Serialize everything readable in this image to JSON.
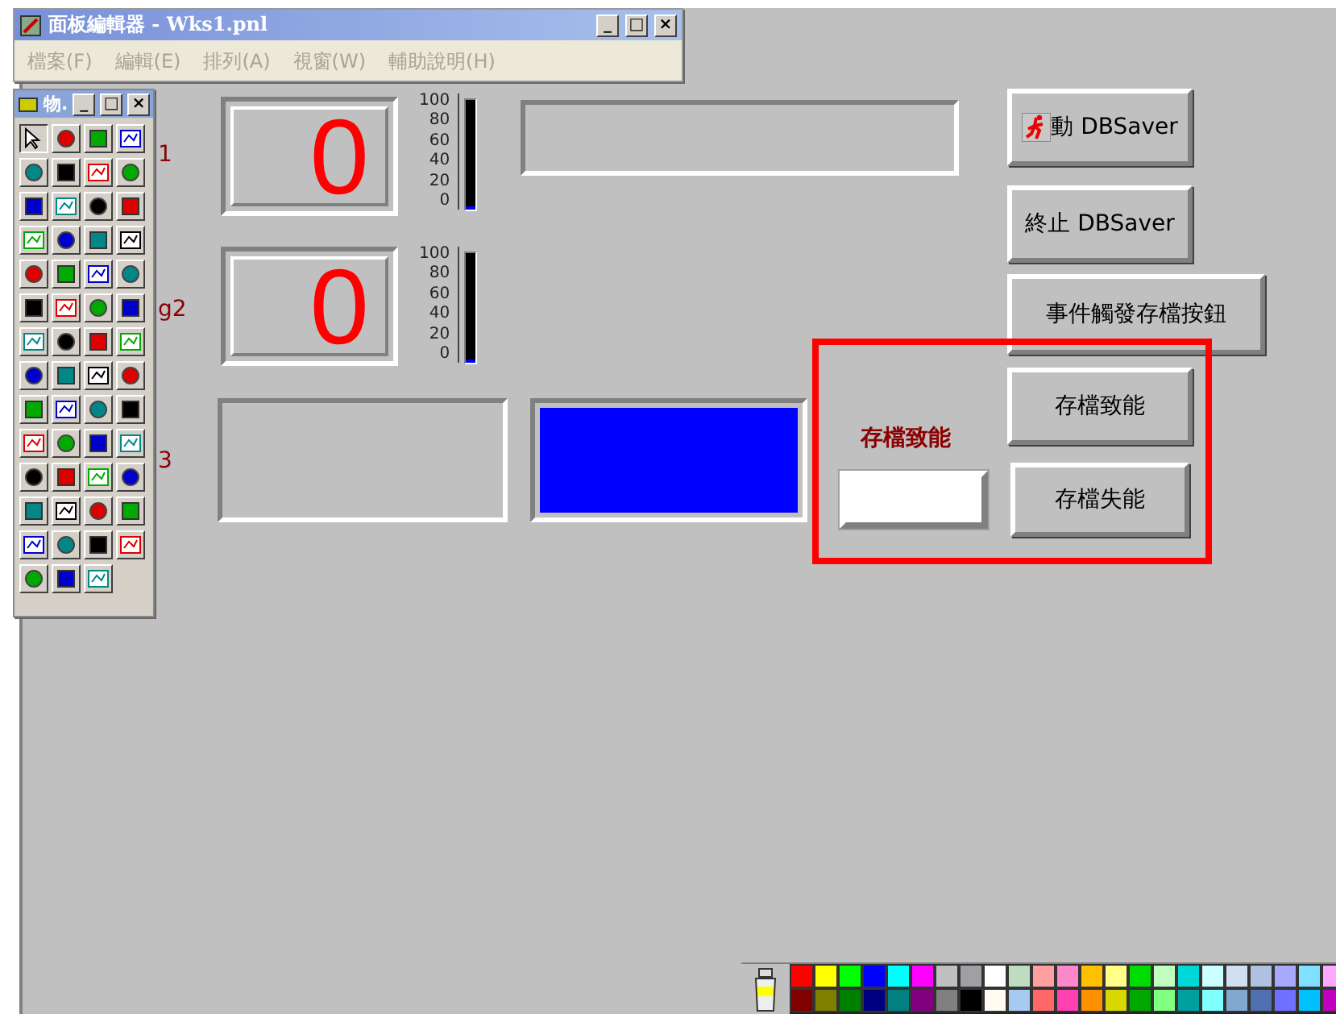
{
  "window": {
    "title": "面板編輯器 - Wks1.pnl",
    "controls": [
      "_",
      "□",
      "×"
    ]
  },
  "menu": [
    {
      "label": "檔案(F)",
      "disabled": true
    },
    {
      "label": "編輯(E)",
      "disabled": true
    },
    {
      "label": "排列(A)",
      "disabled": true
    },
    {
      "label": "視窗(W)",
      "disabled": true
    },
    {
      "label": "輔助說明(H)",
      "disabled": true
    }
  ],
  "toolbox": {
    "title": "物.",
    "controls": [
      "_",
      "□",
      "×"
    ],
    "tools": [
      {
        "selected": true
      },
      {
        "selected": false
      },
      {
        "selected": false
      },
      {
        "selected": false
      },
      {
        "selected": false
      },
      {
        "selected": false
      },
      {
        "selected": false
      },
      {
        "selected": false
      },
      {
        "selected": false
      },
      {
        "selected": false
      },
      {
        "selected": false
      },
      {
        "selected": false
      },
      {
        "selected": false
      },
      {
        "selected": false
      },
      {
        "selected": false
      },
      {
        "selected": false
      },
      {
        "selected": false
      },
      {
        "selected": false
      },
      {
        "selected": false
      },
      {
        "selected": false
      },
      {
        "selected": false
      },
      {
        "selected": false
      },
      {
        "selected": false
      },
      {
        "selected": false
      },
      {
        "selected": false
      },
      {
        "selected": false
      },
      {
        "selected": false
      },
      {
        "selected": false
      },
      {
        "selected": false
      },
      {
        "selected": false
      },
      {
        "selected": false
      },
      {
        "selected": false
      },
      {
        "selected": false
      },
      {
        "selected": false
      },
      {
        "selected": false
      },
      {
        "selected": false
      },
      {
        "selected": false
      },
      {
        "selected": false
      },
      {
        "selected": false
      },
      {
        "selected": false
      },
      {
        "selected": false
      },
      {
        "selected": false
      },
      {
        "selected": false
      },
      {
        "selected": false
      },
      {
        "selected": false
      },
      {
        "selected": false
      },
      {
        "selected": false
      },
      {
        "selected": false
      },
      {
        "selected": false
      },
      {
        "selected": false
      },
      {
        "selected": false
      },
      {
        "selected": false
      },
      {
        "selected": false
      },
      {
        "selected": false
      },
      {
        "selected": false
      }
    ]
  },
  "hidden_labels": [
    "1",
    "g2",
    "3"
  ],
  "displays": [
    {
      "value": "0"
    },
    {
      "value": "0"
    }
  ],
  "meters": [
    {
      "ticks": [
        "100",
        "80",
        "60",
        "40",
        "20",
        "0"
      ],
      "level": 0
    },
    {
      "ticks": [
        "100",
        "80",
        "60",
        "40",
        "20",
        "0"
      ],
      "level": 0
    }
  ],
  "buttons": [
    {
      "label": "動 DBSaver",
      "icon": true
    },
    {
      "label": "終止 DBSaver",
      "icon": false
    },
    {
      "label": "事件觸發存檔按鈕",
      "icon": false
    },
    {
      "label": "存檔致能",
      "icon": false
    },
    {
      "label": "存檔失能",
      "icon": false
    }
  ],
  "status_label": "存檔致能",
  "indicator": {
    "color": "#0000ff"
  },
  "palette": [
    {
      "color": "#ff0000"
    },
    {
      "color": "#ffff00"
    },
    {
      "color": "#00ff00"
    },
    {
      "color": "#0000ff"
    },
    {
      "color": "#00ffff"
    },
    {
      "color": "#ff00ff"
    },
    {
      "color": "#c0c0c0"
    },
    {
      "color": "#a0a0a4"
    },
    {
      "color": "#ffffff"
    },
    {
      "color": "#c0dcc0"
    },
    {
      "color": "#ffa0a0"
    },
    {
      "color": "#ff88cc"
    },
    {
      "color": "#ffc000"
    },
    {
      "color": "#ffff88"
    },
    {
      "color": "#00dd00"
    },
    {
      "color": "#c0ffc0"
    },
    {
      "color": "#00d8d8"
    },
    {
      "color": "#ccffff"
    },
    {
      "color": "#d0e0f0"
    },
    {
      "color": "#b0c0e0"
    },
    {
      "color": "#a8a8ff"
    },
    {
      "color": "#80e0ff"
    },
    {
      "color": "#ffa8ff"
    },
    {
      "color": "#800000"
    },
    {
      "color": "#808000"
    },
    {
      "color": "#008000"
    },
    {
      "color": "#000080"
    },
    {
      "color": "#008080"
    },
    {
      "color": "#800080"
    },
    {
      "color": "#808080"
    },
    {
      "color": "#000000"
    },
    {
      "color": "#fffbf0"
    },
    {
      "color": "#a6caf0"
    },
    {
      "color": "#ff6868"
    },
    {
      "color": "#ff40b0"
    },
    {
      "color": "#ff9000"
    },
    {
      "color": "#d8d800"
    },
    {
      "color": "#00a800"
    },
    {
      "color": "#80ff80"
    },
    {
      "color": "#00a0a0"
    },
    {
      "color": "#80ffff"
    },
    {
      "color": "#80a8d0"
    },
    {
      "color": "#5070b0"
    },
    {
      "color": "#7070ff"
    },
    {
      "color": "#00c0ff"
    },
    {
      "color": "#c000c0"
    }
  ]
}
